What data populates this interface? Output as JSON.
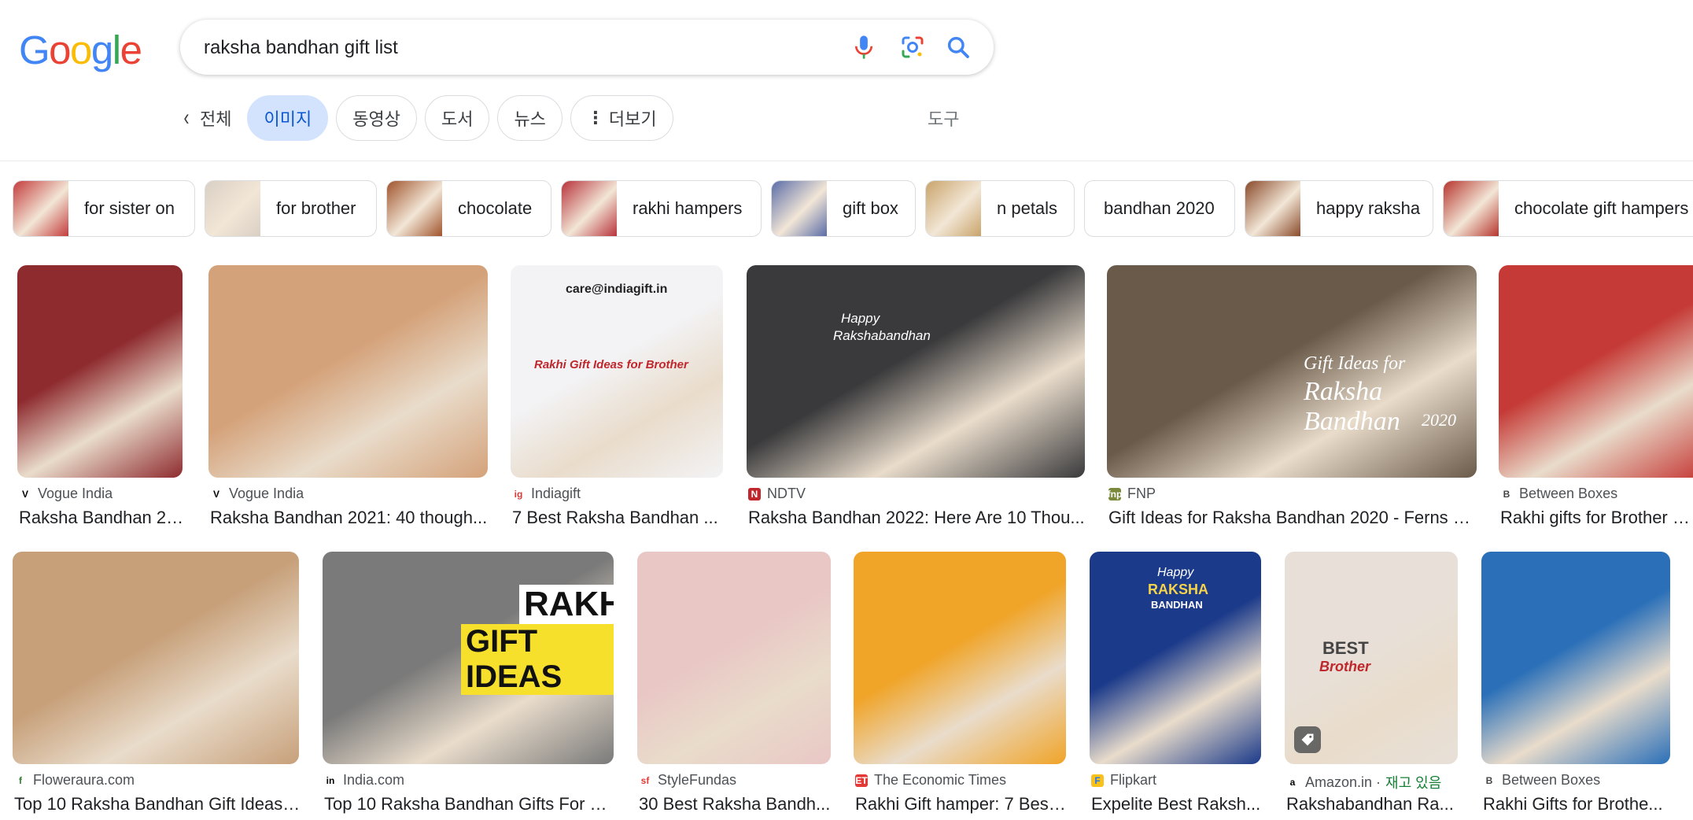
{
  "logo": {
    "letters": [
      {
        "ch": "G",
        "color": "#4285F4"
      },
      {
        "ch": "o",
        "color": "#EA4335"
      },
      {
        "ch": "o",
        "color": "#FBBC05"
      },
      {
        "ch": "g",
        "color": "#4285F4"
      },
      {
        "ch": "l",
        "color": "#34A853"
      },
      {
        "ch": "e",
        "color": "#EA4335"
      }
    ]
  },
  "search": {
    "query": "raksha bandhan gift list"
  },
  "tabs": {
    "back_label": "전체",
    "items": [
      "이미지",
      "동영상",
      "도서",
      "뉴스"
    ],
    "more_label": "더보기",
    "tools_label": "도구"
  },
  "related": [
    {
      "label": "for sister on",
      "thumb": "#c43c3c"
    },
    {
      "label": "for brother",
      "thumb": "#d9cfc4"
    },
    {
      "label": "chocolate",
      "thumb": "#a0542c"
    },
    {
      "label": "rakhi hampers",
      "thumb": "#b8333c"
    },
    {
      "label": "gift box",
      "thumb": "#5b6da8"
    },
    {
      "label": "n petals",
      "thumb": "#c9a46a"
    },
    {
      "label": "bandhan 2020",
      "thumb": ""
    },
    {
      "label": "happy raksha",
      "thumb": "#8a4a2a"
    },
    {
      "label": "chocolate gift hampers",
      "thumb": "#b7352e"
    }
  ],
  "results_row1": [
    {
      "source": "Vogue India",
      "title": "Raksha Bandhan 20...",
      "fav": "V",
      "favbg": "#ffffff",
      "favfg": "#000000",
      "bg": "#8e2b2f"
    },
    {
      "source": "Vogue India",
      "title": "Raksha Bandhan 2021: 40 though...",
      "fav": "V",
      "favbg": "#ffffff",
      "favfg": "#000000",
      "bg": "#d4a27a"
    },
    {
      "source": "Indiagift",
      "title": "7 Best Raksha Bandhan ...",
      "fav": "ig",
      "favbg": "#ffffff",
      "favfg": "#d33b3b",
      "bg": "#f3f3f5"
    },
    {
      "source": "NDTV",
      "title": "Raksha Bandhan 2022: Here Are 10 Thou...",
      "fav": "N",
      "favbg": "#c0272d",
      "favfg": "#ffffff",
      "bg": "#3a3a3c"
    },
    {
      "source": "FNP",
      "title": "Gift Ideas for Raksha Bandhan 2020 - Ferns N...",
      "fav": "fnp",
      "favbg": "#7a8a3a",
      "favfg": "#ffffff",
      "bg": "#6a5a4a"
    },
    {
      "source": "Between Boxes",
      "title": "Rakhi gifts for Brother Deli...",
      "fav": "B",
      "favbg": "#ffffff",
      "favfg": "#444444",
      "bg": "#c53a36"
    }
  ],
  "results_row2": [
    {
      "source": "Floweraura.com",
      "title": "Top 10 Raksha Bandhan Gift Ideas ...",
      "fav": "f",
      "favbg": "#ffffff",
      "favfg": "#2e7d32",
      "bg": "#c7a07a"
    },
    {
      "source": "India.com",
      "title": "Top 10 Raksha Bandhan Gifts For S...",
      "fav": "in",
      "favbg": "#ffffff",
      "favfg": "#000000",
      "bg": "#7a7a7a"
    },
    {
      "source": "StyleFundas",
      "title": "30 Best Raksha Bandh...",
      "fav": "sf",
      "favbg": "#ffffff",
      "favfg": "#e53935",
      "bg": "#e9c7c5"
    },
    {
      "source": "The Economic Times",
      "title": "Rakhi Gift hamper: 7 Best...",
      "fav": "ET",
      "favbg": "#e53935",
      "favfg": "#ffffff",
      "bg": "#f0a428"
    },
    {
      "source": "Flipkart",
      "title": "Expelite Best Raksh...",
      "fav": "F",
      "favbg": "#f9c21a",
      "favfg": "#2874f0",
      "bg": "#1b3a8a"
    },
    {
      "source": "Amazon.in",
      "title": "Rakshabandhan Ra...",
      "fav": "a",
      "favbg": "#ffffff",
      "favfg": "#000000",
      "bg": "#e8e0d8",
      "in_stock": "재고 있음"
    },
    {
      "source": "Between Boxes",
      "title": "Rakhi Gifts for Brothe...",
      "fav": "B",
      "favbg": "#ffffff",
      "favfg": "#444444",
      "bg": "#2a6fb8"
    }
  ],
  "image_overlays": {
    "gift_ideas_line1": "Gift Ideas for",
    "gift_ideas_line2": "Raksha Bandhan",
    "gift_ideas_year": "2020",
    "happy_line1": "Happy",
    "happy_line2": "Rakshabandhan",
    "rakhi_banner": "RAKH",
    "gift_ideas_banner": "GIFT IDEAS",
    "indiagift_email": "care@indiagift.in",
    "indiagift_caption": "Rakhi Gift Ideas for Brother",
    "flipkart_happy": "Happy",
    "flipkart_raksha": "RAKSHA",
    "flipkart_bandhan": "BANDHAN",
    "amazon_best": "BEST",
    "amazon_brother": "Brother"
  },
  "colors": {
    "accent_blue": "#0b57d0",
    "active_tab_bg": "#d3e3fd",
    "in_stock_green": "#188038"
  }
}
